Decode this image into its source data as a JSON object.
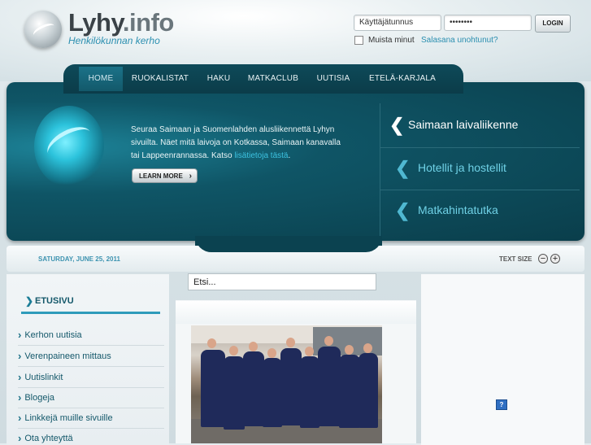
{
  "header": {
    "logo_main": "Lyhy",
    "logo_tld": ".info",
    "tagline": "Henkilökunnan kerho",
    "login": {
      "username_value": "Käyttäjätunnus",
      "password_value": "••••••••",
      "login_button": "LOGIN",
      "remember_label": "Muista minut",
      "forgot_link": "Salasana unohtunut?"
    }
  },
  "nav": {
    "items": [
      "HOME",
      "RUOKALISTAT",
      "HAKU",
      "MATKACLUB",
      "UUTISIA",
      "ETELÄ-KARJALA"
    ],
    "active": "HOME"
  },
  "hero": {
    "text_lines": [
      "Seuraa Saimaan ja Suomenlahden alusliikennettä Lyhyn",
      "sivuilta. Näet mitä laivoja on Kotkassa, Saimaan kanavalla",
      "tai Lappeenrannassa. Katso "
    ],
    "link_text": "lisätietoja tästä",
    "link_suffix": ".",
    "learn_more": "LEARN MORE",
    "side_items": [
      "Saimaan laivaliikenne",
      "Hotellit ja hostellit",
      "Matkahintatutka"
    ]
  },
  "bar": {
    "date": "SATURDAY, JUNE 25, 2011",
    "text_size_label": "TEXT SIZE",
    "decrease": "−",
    "increase": "+"
  },
  "search": {
    "value": "Etsi..."
  },
  "sidebar": {
    "title": "ETUSIVU",
    "items": [
      "Kerhon uutisia",
      "Verenpaineen mittaus",
      "Uutislinkit",
      "Blogeja",
      "Linkkejä muille sivuille",
      "Ota yhteyttä"
    ]
  },
  "colors": {
    "accent": "#2f9bbb",
    "nav_bg": "#0e4a59",
    "hero_bg": "#0f5566",
    "link": "#2b8fb0"
  },
  "icons": {
    "logo": "logo-swirl-icon",
    "hero": "swirl-graphic-icon",
    "chevron": "chevron-left-icon",
    "help": "help-icon"
  }
}
